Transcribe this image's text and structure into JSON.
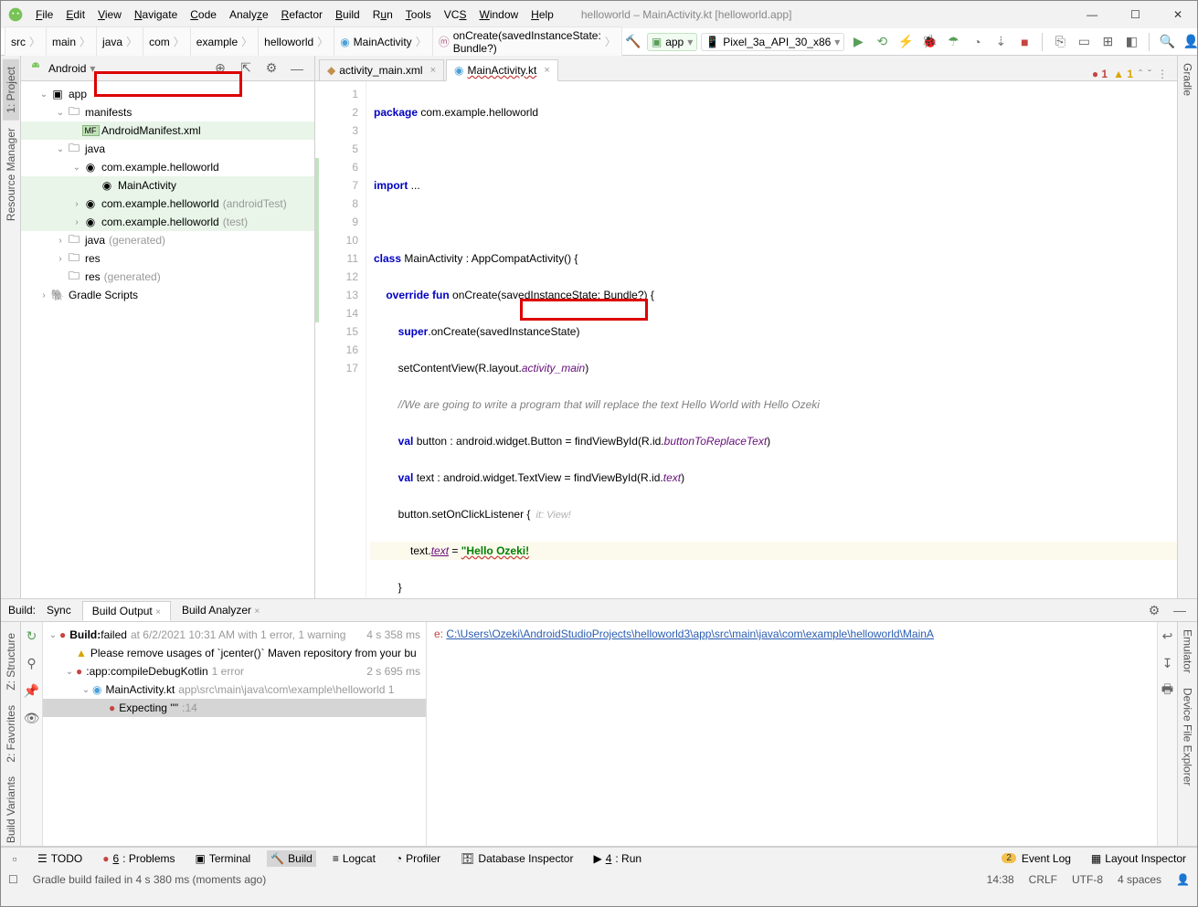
{
  "window": {
    "title": "helloworld – MainActivity.kt [helloworld.app]"
  },
  "menu": [
    "File",
    "Edit",
    "View",
    "Navigate",
    "Code",
    "Analyze",
    "Refactor",
    "Build",
    "Run",
    "Tools",
    "VCS",
    "Window",
    "Help"
  ],
  "breadcrumbs": [
    "src",
    "main",
    "java",
    "com",
    "example",
    "helloworld",
    "MainActivity",
    "onCreate(savedInstanceState: Bundle?)"
  ],
  "run_config": {
    "app": "app",
    "device": "Pixel_3a_API_30_x86"
  },
  "leftrail_tabs": [
    "1: Project",
    "Resource Manager"
  ],
  "project_pane": {
    "title": "Android",
    "tree": [
      {
        "indent": 0,
        "tw": "v",
        "icon": "mod",
        "label": "app"
      },
      {
        "indent": 1,
        "tw": "v",
        "icon": "folder",
        "label": "manifests"
      },
      {
        "indent": 2,
        "tw": "",
        "icon": "mf",
        "label": "AndroidManifest.xml",
        "hl": true
      },
      {
        "indent": 1,
        "tw": "v",
        "icon": "folder",
        "label": "java"
      },
      {
        "indent": 2,
        "tw": "v",
        "icon": "pkg",
        "label": "com.example.helloworld"
      },
      {
        "indent": 3,
        "tw": "",
        "icon": "kt",
        "label": "MainActivity",
        "hl": true
      },
      {
        "indent": 2,
        "tw": ">",
        "icon": "pkg",
        "label": "com.example.helloworld",
        "muted": "(androidTest)",
        "hl": true
      },
      {
        "indent": 2,
        "tw": ">",
        "icon": "pkg",
        "label": "com.example.helloworld",
        "muted": "(test)",
        "hl": true
      },
      {
        "indent": 1,
        "tw": ">",
        "icon": "folderm",
        "label": "java",
        "muted": "(generated)"
      },
      {
        "indent": 1,
        "tw": ">",
        "icon": "folder",
        "label": "res"
      },
      {
        "indent": 1,
        "tw": "",
        "icon": "folderm",
        "label": "res",
        "muted": "(generated)"
      },
      {
        "indent": 0,
        "tw": ">",
        "icon": "gradle",
        "label": "Gradle Scripts"
      }
    ]
  },
  "tabs": [
    {
      "label": "activity_main.xml",
      "active": false,
      "icon": "xml"
    },
    {
      "label": "MainActivity.kt",
      "active": true,
      "icon": "kt"
    }
  ],
  "editor": {
    "err_count": "1",
    "warn_count": "1",
    "lines": [
      1,
      2,
      3,
      5,
      6,
      7,
      8,
      9,
      10,
      11,
      12,
      13,
      14,
      15,
      16,
      17
    ]
  },
  "code": {
    "l1_a": "package",
    "l1_b": " com.example.helloworld",
    "l3_a": "import",
    "l3_b": " ...",
    "l6_a": "class",
    "l6_b": " MainActivity : AppCompatActivity() {",
    "l7_a": "    override fun",
    "l7_b": " onCreate(savedInstanceState: Bundle?) {",
    "l8_a": "        super",
    "l8_b": ".onCreate(savedInstanceState)",
    "l9_a": "        setContentView(R.layout.",
    "l9_b": "activity_main",
    "l9_c": ")",
    "l10": "        //We are going to write a program that will replace the text Hello World with Hello Ozeki",
    "l11_a": "        val",
    "l11_b": " button : android.widget.Button = findViewById(R.id.",
    "l11_c": "buttonToReplaceText",
    "l11_d": ")",
    "l12_a": "        val",
    "l12_b": " text : android.widget.TextView = findViewById(R.id.",
    "l12_c": "text",
    "l12_d": ")",
    "l13_a": "        button.setOnClickListener ",
    "l13_b": "{",
    "l13_h": "  it: View!",
    "l14_a": "            text.",
    "l14_b": "text",
    "l14_c": " = ",
    "l14_d": "\"Hello Ozeki!",
    "l15": "        }",
    "l16": "    }",
    "l17": "}"
  },
  "build_panel": {
    "label": "Build:",
    "tabs": [
      "Sync",
      "Build Output",
      "Build Analyzer"
    ],
    "active_tab": 1,
    "tree": [
      {
        "indent": 0,
        "tw": "v",
        "type": "err",
        "bold": "Build:",
        "text": "failed",
        "muted": "at 6/2/2021 10:31 AM with 1 error, 1 warning",
        "right": "4 s 358 ms"
      },
      {
        "indent": 1,
        "tw": "",
        "type": "warn",
        "text": "Please remove usages of `jcenter()` Maven repository from your bu"
      },
      {
        "indent": 1,
        "tw": "v",
        "type": "err",
        "text": ":app:compileDebugKotlin",
        "muted": "1 error",
        "right": "2 s 695 ms"
      },
      {
        "indent": 2,
        "tw": "v",
        "type": "file",
        "text": "MainActivity.kt",
        "muted": "app\\src\\main\\java\\com\\example\\helloworld 1"
      },
      {
        "indent": 3,
        "tw": "",
        "type": "err",
        "text": "Expecting '\"'",
        "muted": ":14",
        "sel": true
      }
    ],
    "output_prefix": "e: ",
    "output_link": "C:\\Users\\Ozeki\\AndroidStudioProjects\\helloworld3\\app\\src\\main\\java\\com\\example\\helloworld\\MainA"
  },
  "bottom_tools": [
    "TODO",
    "6: Problems",
    "Terminal",
    "Build",
    "Logcat",
    "Profiler",
    "Database Inspector",
    "4: Run"
  ],
  "bottom_tools_right": [
    "Event Log",
    "Layout Inspector"
  ],
  "event_log_count": "2",
  "status": {
    "msg": "Gradle build failed in 4 s 380 ms (moments ago)",
    "pos": "14:38",
    "le": "CRLF",
    "enc": "UTF-8",
    "indent": "4 spaces"
  },
  "right_rail": [
    "Gradle",
    "Emulator",
    "Device File Explorer"
  ],
  "left_bottom_rail": [
    "Z: Structure",
    "2: Favorites",
    "Build Variants"
  ]
}
